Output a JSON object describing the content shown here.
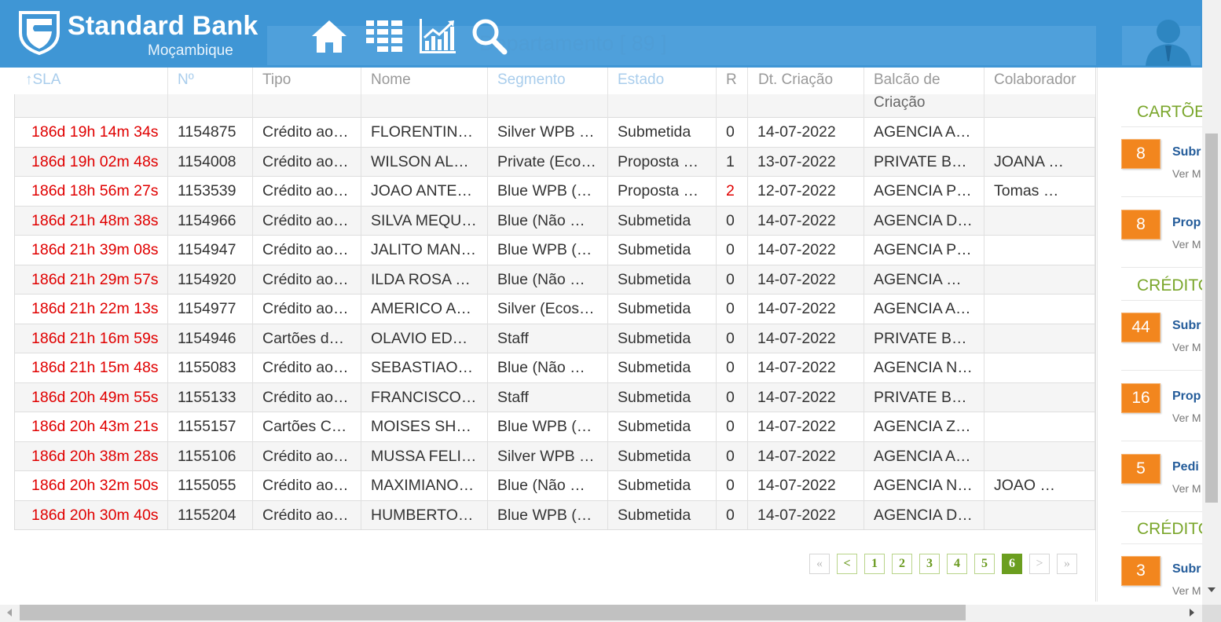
{
  "brand": {
    "name": "Standard Bank",
    "subtitle": "Moçambique"
  },
  "header": {
    "ghost_title": "Departamento [ 89 ]"
  },
  "nav": [
    {
      "icon": "home-icon"
    },
    {
      "icon": "grid-icon"
    },
    {
      "icon": "chart-icon"
    },
    {
      "icon": "search-icon"
    }
  ],
  "user": {
    "icon": "user-avatar-icon"
  },
  "colors": {
    "topbar": "#3f96d5",
    "sla_red": "#e00000",
    "badge_orange": "#f2861e",
    "section_green": "#7aa62b",
    "pager_green": "#6b9e1f"
  },
  "table": {
    "columns": [
      "↑SLA",
      "Nº",
      "Tipo",
      "Nome",
      "Segmento",
      "Estado",
      "R",
      "Dt. Criação",
      "Balcão de",
      "Criação",
      "Colaborador"
    ],
    "rows": [
      [
        "186d 19h 14m 34s",
        "1154875",
        "Crédito ao…",
        "FLORENTIN…",
        "Silver WPB …",
        "Submetida",
        "0",
        "14-07-2022",
        "AGENCIA A…",
        ""
      ],
      [
        "186d 19h 02m 48s",
        "1154008",
        "Crédito ao…",
        "WILSON AL…",
        "Private (Eco…",
        "Proposta …",
        "1",
        "13-07-2022",
        "PRIVATE B…",
        "JOANA …"
      ],
      [
        "186d 18h 56m 27s",
        "1153539",
        "Crédito ao…",
        "JOAO ANTE…",
        "Blue WPB (…",
        "Proposta …",
        "2",
        "12-07-2022",
        "AGENCIA P…",
        "Tomas …"
      ],
      [
        "186d 21h 48m 38s",
        "1154966",
        "Crédito ao…",
        "SILVA MEQU…",
        "Blue (Não …",
        "Submetida",
        "0",
        "14-07-2022",
        "AGENCIA D…",
        ""
      ],
      [
        "186d 21h 39m 08s",
        "1154947",
        "Crédito ao…",
        "JALITO MAN…",
        "Blue WPB (…",
        "Submetida",
        "0",
        "14-07-2022",
        "AGENCIA P…",
        ""
      ],
      [
        "186d 21h 29m 57s",
        "1154920",
        "Crédito ao…",
        "ILDA ROSA …",
        "Blue (Não …",
        "Submetida",
        "0",
        "14-07-2022",
        "AGENCIA …",
        ""
      ],
      [
        "186d 21h 22m 13s",
        "1154977",
        "Crédito ao…",
        "AMERICO A…",
        "Silver (Ecos…",
        "Submetida",
        "0",
        "14-07-2022",
        "AGENCIA A…",
        ""
      ],
      [
        "186d 21h 16m 59s",
        "1154946",
        "Cartões d…",
        "OLAVIO ED…",
        "Staff",
        "Submetida",
        "0",
        "14-07-2022",
        "PRIVATE B…",
        ""
      ],
      [
        "186d 21h 15m 48s",
        "1155083",
        "Crédito ao…",
        "SEBASTIAO…",
        "Blue (Não …",
        "Submetida",
        "0",
        "14-07-2022",
        "AGENCIA N…",
        ""
      ],
      [
        "186d 20h 49m 55s",
        "1155133",
        "Crédito ao…",
        "FRANCISCO…",
        "Staff",
        "Submetida",
        "0",
        "14-07-2022",
        "PRIVATE B…",
        ""
      ],
      [
        "186d 20h 43m 21s",
        "1155157",
        "Cartões C…",
        "MOISES SH…",
        "Blue WPB (…",
        "Submetida",
        "0",
        "14-07-2022",
        "AGENCIA Z…",
        ""
      ],
      [
        "186d 20h 38m 28s",
        "1155106",
        "Crédito ao…",
        "MUSSA FELI…",
        "Silver WPB …",
        "Submetida",
        "0",
        "14-07-2022",
        "AGENCIA A…",
        ""
      ],
      [
        "186d 20h 32m 50s",
        "1155055",
        "Crédito ao…",
        "MAXIMIANO…",
        "Blue (Não …",
        "Submetida",
        "0",
        "14-07-2022",
        "AGENCIA N…",
        "JOAO …"
      ],
      [
        "186d 20h 30m 40s",
        "1155204",
        "Crédito ao…",
        "HUMBERTO…",
        "Blue WPB (…",
        "Submetida",
        "0",
        "14-07-2022",
        "AGENCIA D…",
        ""
      ]
    ]
  },
  "pagination": {
    "first": "«",
    "prev": "<",
    "pages": [
      "1",
      "2",
      "3",
      "4",
      "5",
      "6"
    ],
    "current": "6",
    "next": ">",
    "last": "»"
  },
  "right_panel": {
    "sections": [
      {
        "title": "CARTÕE",
        "cards": [
          {
            "count": "8",
            "title": "Subr",
            "link": "Ver M"
          },
          {
            "count": "8",
            "title": "Prop",
            "link": "Ver M"
          }
        ]
      },
      {
        "title": "CRÉDITO",
        "cards": [
          {
            "count": "44",
            "title": "Subr",
            "link": "Ver M"
          },
          {
            "count": "16",
            "title": "Prop",
            "link": "Ver M"
          },
          {
            "count": "5",
            "title": "Pedi",
            "link": "Ver M"
          }
        ]
      },
      {
        "title": "CRÉDITO",
        "cards": [
          {
            "count": "3",
            "title": "Subr",
            "link": "Ver M"
          }
        ]
      }
    ]
  }
}
